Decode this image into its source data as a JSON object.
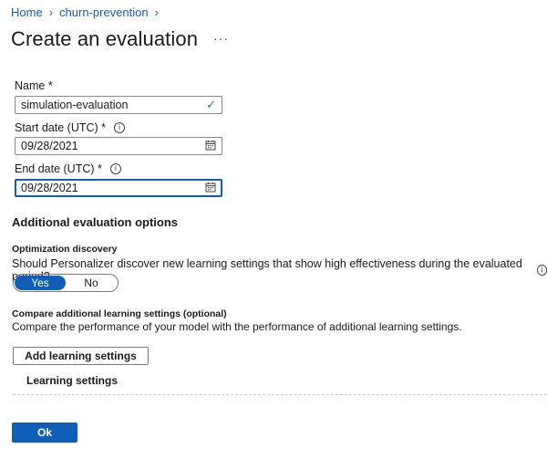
{
  "breadcrumb": {
    "home": "Home",
    "current": "churn-prevention"
  },
  "page": {
    "title": "Create an evaluation",
    "more": "···"
  },
  "form": {
    "name": {
      "label": "Name *",
      "value": "simulation-evaluation"
    },
    "start": {
      "label": "Start date (UTC) *",
      "value": "09/28/2021"
    },
    "end": {
      "label": "End date (UTC) *",
      "value": "09/28/2021"
    }
  },
  "additional": {
    "title": "Additional evaluation options",
    "optimization": {
      "heading": "Optimization discovery",
      "question": "Should Personalizer discover new learning settings that show high effectiveness during the evaluated period?",
      "yes": "Yes",
      "no": "No",
      "selected": "Yes"
    },
    "compare": {
      "heading": "Compare additional learning settings (optional)",
      "description": "Compare the performance of your model with the performance of additional learning settings.",
      "add_button": "Add learning settings",
      "list_label": "Learning settings"
    }
  },
  "footer": {
    "ok": "Ok"
  },
  "colors": {
    "accent": "#0f5fb8",
    "valid": "#2e8b39"
  }
}
